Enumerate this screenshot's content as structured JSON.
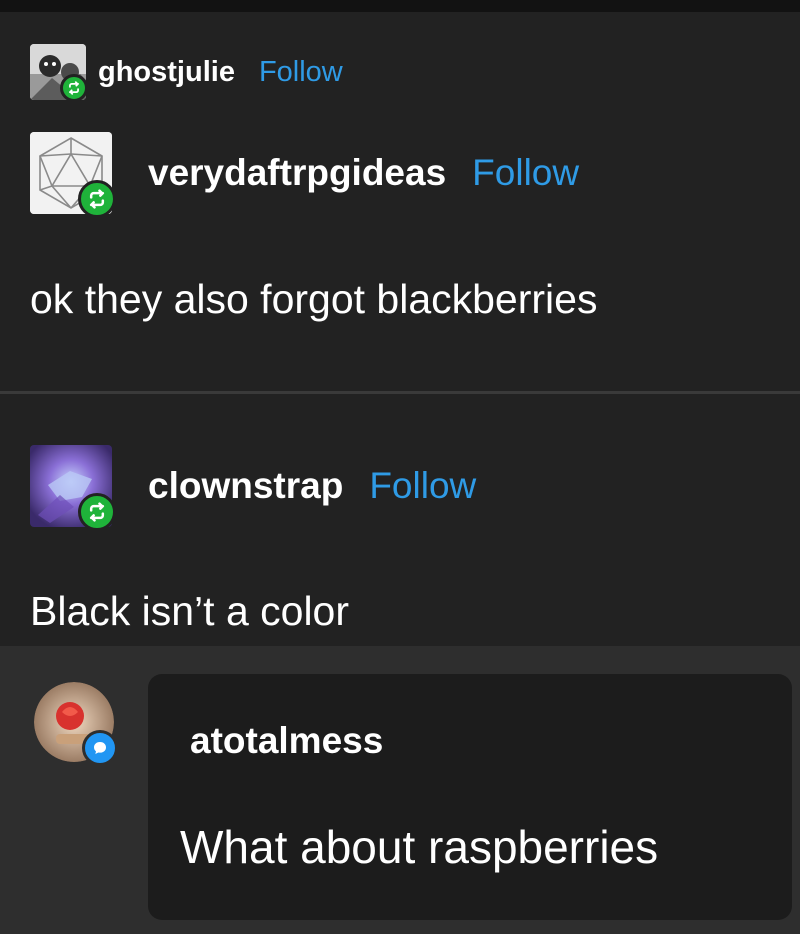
{
  "posts": [
    {
      "username": "ghostjulie",
      "follow_label": "Follow",
      "badge_icon": "reblog-icon"
    },
    {
      "username": "verydaftrpgideas",
      "follow_label": "Follow",
      "badge_icon": "reblog-icon",
      "text": "ok they also forgot blackberries"
    },
    {
      "username": "clownstrap",
      "follow_label": "Follow",
      "badge_icon": "reblog-icon",
      "text": "Black isn’t a color"
    }
  ],
  "reply": {
    "username": "atotalmess",
    "text": "What about raspberries",
    "badge_icon": "reply-bubble-icon"
  },
  "colors": {
    "background": "#222222",
    "follow": "#2f9be6",
    "reblog_badge": "#1fb33a",
    "reply_badge": "#2196f3",
    "reply_area": "#2e2e2e",
    "reply_bubble": "#1c1c1c"
  }
}
